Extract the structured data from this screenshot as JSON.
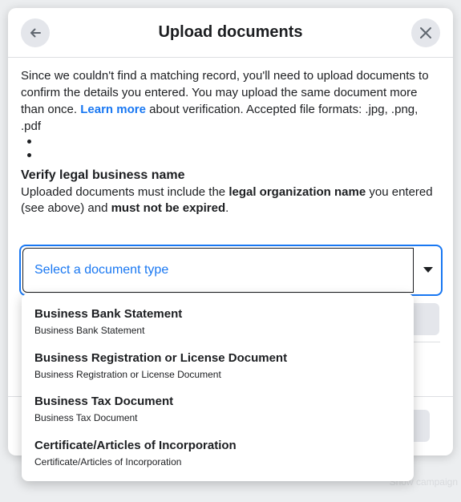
{
  "background": {
    "ghost_text": "Show campaign"
  },
  "modal": {
    "title": "Upload documents",
    "intro_before_link": "Since we couldn't find a matching record, you'll need to upload documents to confirm the details you entered. You may upload the same document more than once. ",
    "learn_more": "Learn more",
    "intro_after_link": " about verification. Accepted file formats: .jpg, .png, .pdf",
    "section": {
      "title": "Verify legal business name",
      "desc_1": "Uploaded documents must include the ",
      "desc_bold_1": "legal organization name",
      "desc_2": " you entered (see above) and ",
      "desc_bold_2": "must not be expired",
      "desc_3": "."
    },
    "select": {
      "placeholder": "Select a document type"
    },
    "options": [
      {
        "title": "Business Bank Statement",
        "subtitle": "Business Bank Statement"
      },
      {
        "title": "Business Registration or License Document",
        "subtitle": "Business Registration or License Document"
      },
      {
        "title": "Business Tax Document",
        "subtitle": "Business Tax Document"
      },
      {
        "title": "Certificate/Articles of Incorporation",
        "subtitle": "Certificate/Articles of Incorporation"
      }
    ]
  },
  "colors": {
    "accent": "#1877f2",
    "text": "#1c1e21",
    "button_bg": "#e4e6eb"
  },
  "icons": {
    "back": "arrow-left-icon",
    "close": "close-icon",
    "caret": "caret-down-icon"
  }
}
